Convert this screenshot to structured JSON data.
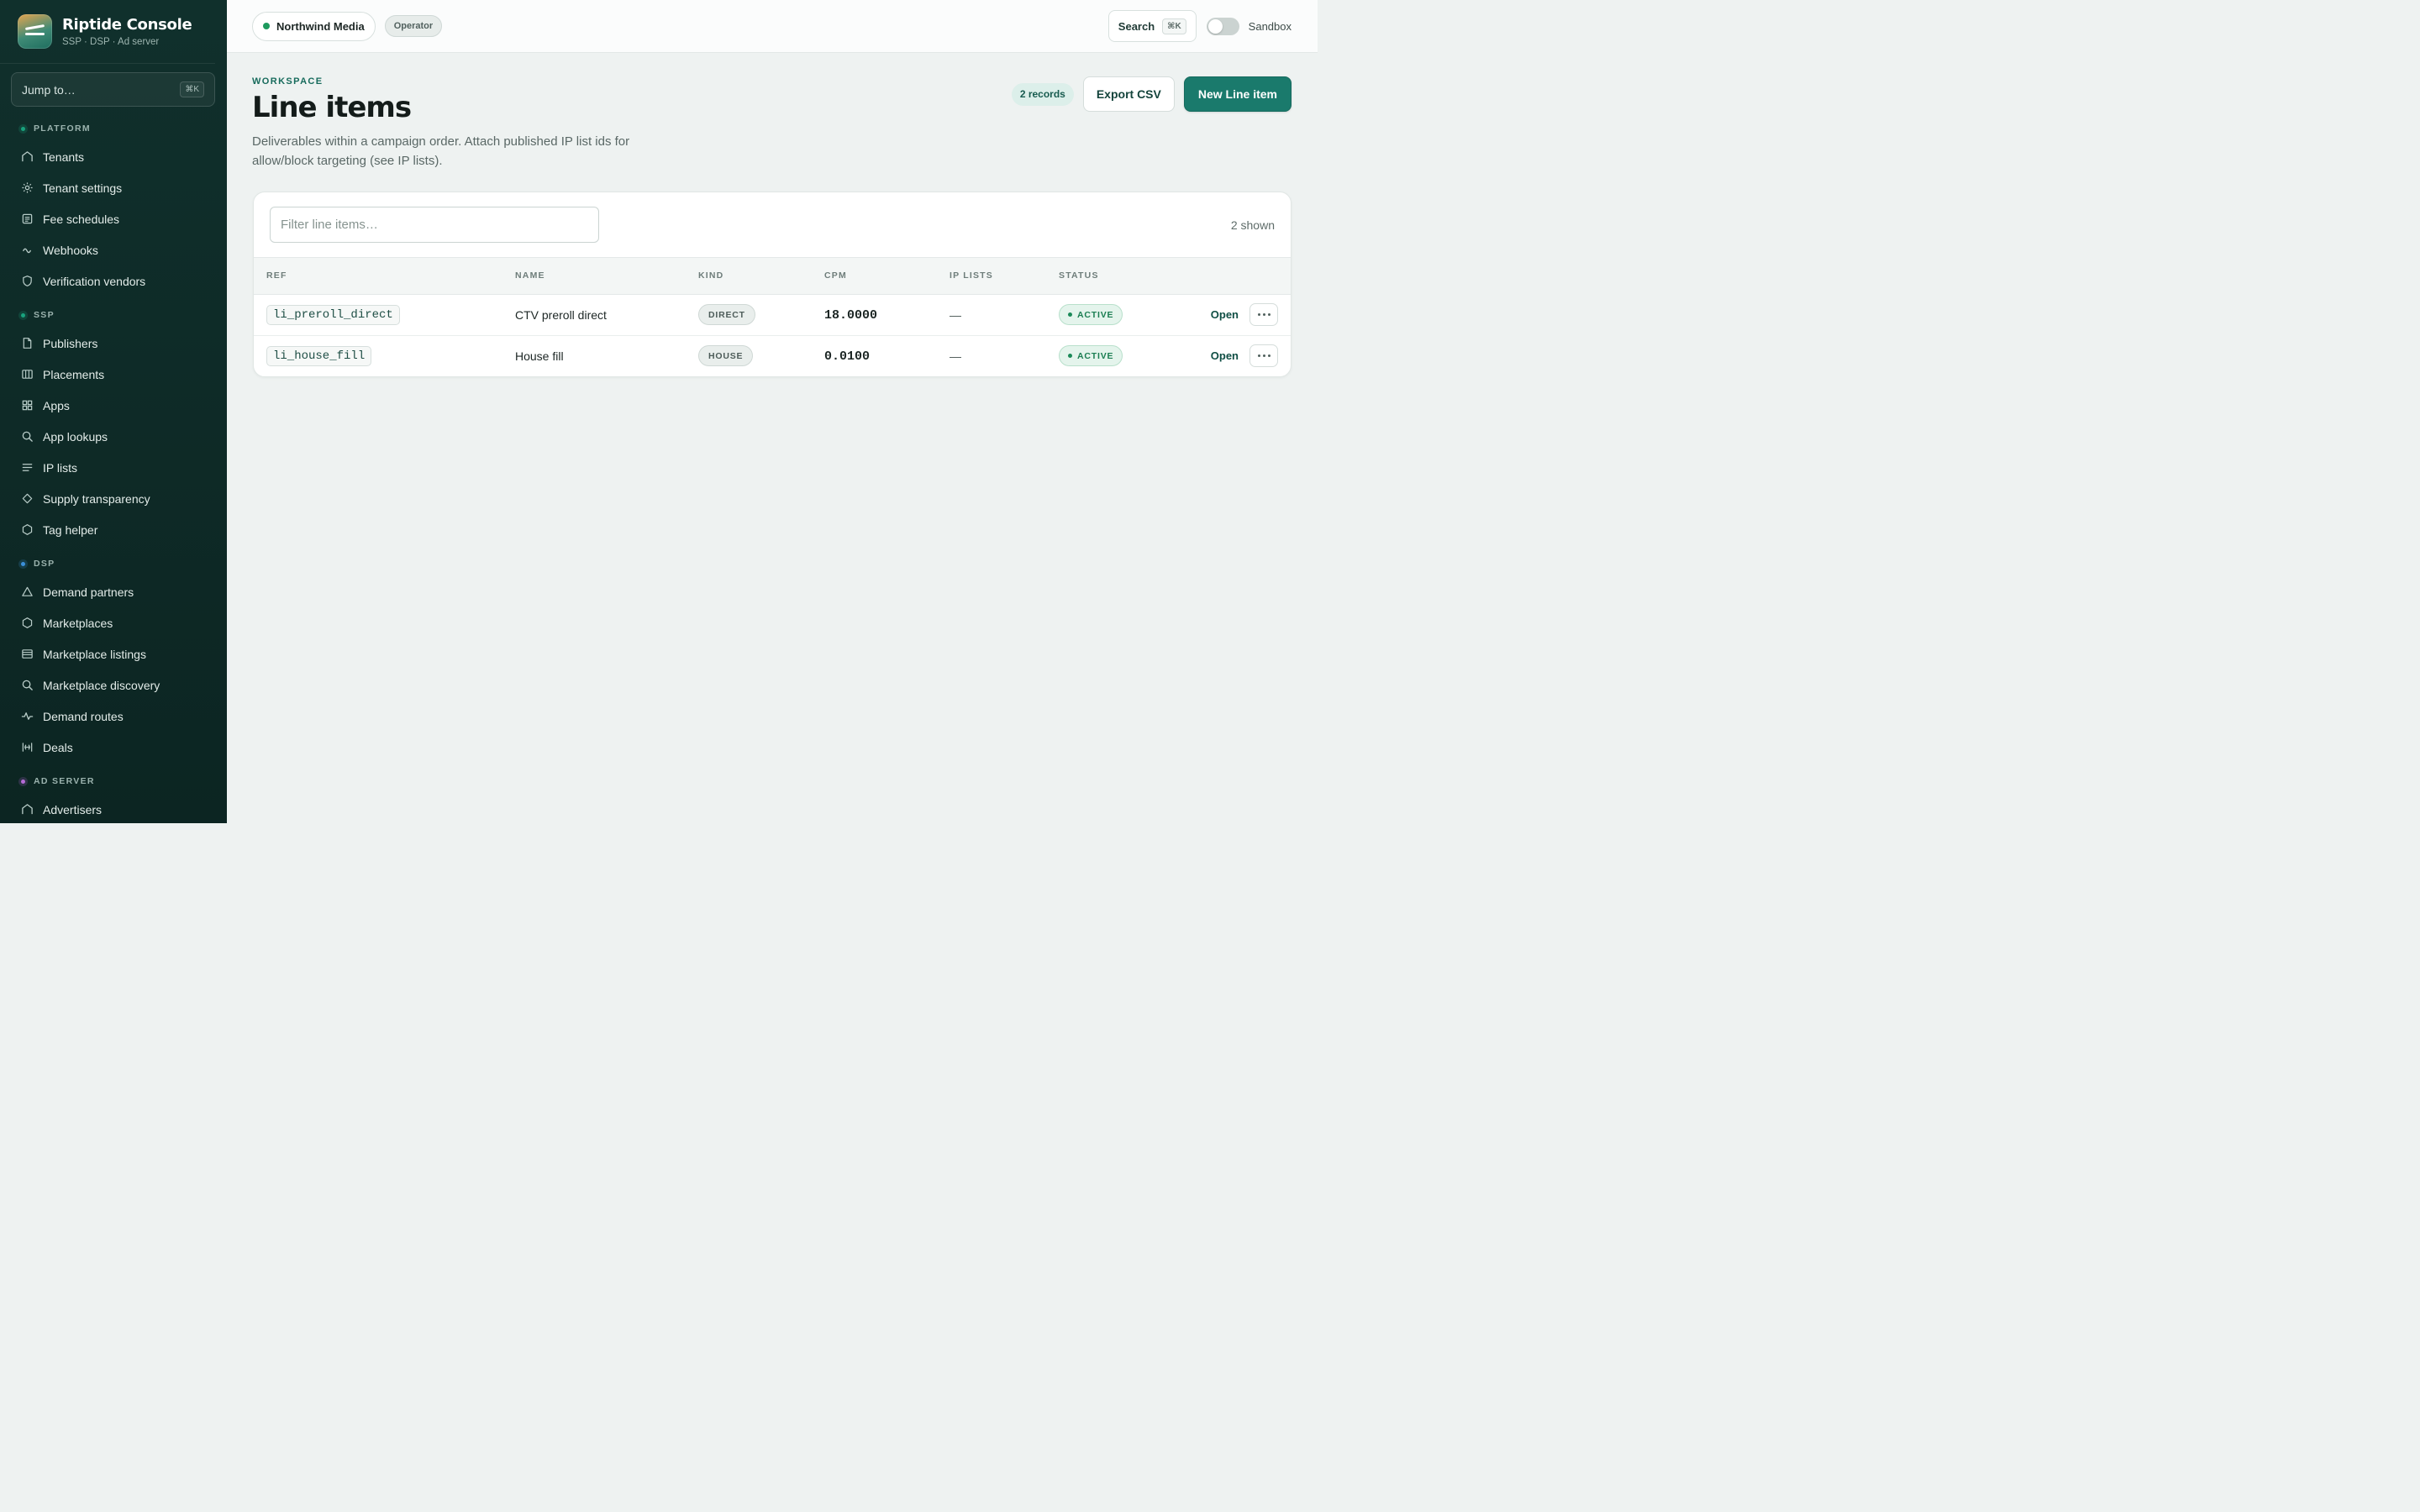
{
  "brand": {
    "title": "Riptide Console",
    "subtitle": "SSP · DSP · Ad server"
  },
  "jump": {
    "label": "Jump to…",
    "shortcut": "⌘K"
  },
  "sidebar": {
    "sections": [
      {
        "label": "PLATFORM",
        "color": "#19a37e",
        "items": [
          {
            "label": "Tenants",
            "icon": "home-icon"
          },
          {
            "label": "Tenant settings",
            "icon": "gear-icon"
          },
          {
            "label": "Fee schedules",
            "icon": "document-icon"
          },
          {
            "label": "Webhooks",
            "icon": "webhook-icon"
          },
          {
            "label": "Verification vendors",
            "icon": "shield-icon"
          }
        ]
      },
      {
        "label": "SSP",
        "color": "#19a37e",
        "items": [
          {
            "label": "Publishers",
            "icon": "file-icon"
          },
          {
            "label": "Placements",
            "icon": "columns-icon"
          },
          {
            "label": "Apps",
            "icon": "grid-icon"
          },
          {
            "label": "App lookups",
            "icon": "search-icon"
          },
          {
            "label": "IP lists",
            "icon": "list-icon"
          },
          {
            "label": "Supply transparency",
            "icon": "diamond-icon"
          },
          {
            "label": "Tag helper",
            "icon": "hexagon-icon"
          }
        ]
      },
      {
        "label": "DSP",
        "color": "#3b8fd9",
        "items": [
          {
            "label": "Demand partners",
            "icon": "triangle-icon"
          },
          {
            "label": "Marketplaces",
            "icon": "hexagon-icon"
          },
          {
            "label": "Marketplace listings",
            "icon": "layers-icon"
          },
          {
            "label": "Marketplace discovery",
            "icon": "search-icon"
          },
          {
            "label": "Demand routes",
            "icon": "pulse-icon"
          },
          {
            "label": "Deals",
            "icon": "handshake-icon"
          }
        ]
      },
      {
        "label": "AD SERVER",
        "color": "#b56bd6",
        "items": [
          {
            "label": "Advertisers",
            "icon": "home-icon"
          }
        ]
      }
    ]
  },
  "topbar": {
    "tenant": "Northwind Media",
    "role": "Operator",
    "search_label": "Search",
    "search_shortcut": "⌘K",
    "sandbox_label": "Sandbox",
    "sandbox_on": false
  },
  "page": {
    "eyebrow": "WORKSPACE",
    "title": "Line items",
    "description": "Deliverables within a campaign order. Attach published IP list ids for allow/block targeting (see IP lists).",
    "record_count": "2 records",
    "export_label": "Export CSV",
    "new_label": "New Line item"
  },
  "table": {
    "filter_placeholder": "Filter line items…",
    "shown": "2 shown",
    "columns": [
      "REF",
      "NAME",
      "KIND",
      "CPM",
      "IP LISTS",
      "STATUS"
    ],
    "rows": [
      {
        "ref": "li_preroll_direct",
        "name": "CTV preroll direct",
        "kind": "DIRECT",
        "cpm": "18.0000",
        "ip_lists": "—",
        "status": "ACTIVE",
        "action": "Open"
      },
      {
        "ref": "li_house_fill",
        "name": "House fill",
        "kind": "HOUSE",
        "cpm": "0.0100",
        "ip_lists": "—",
        "status": "ACTIVE",
        "action": "Open"
      }
    ]
  }
}
